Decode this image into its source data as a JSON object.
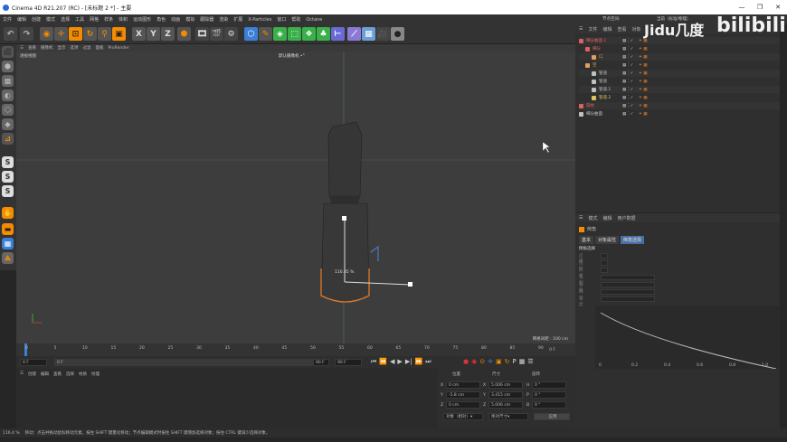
{
  "window": {
    "title": "Cinema 4D R21.207 (RC) - [未标题 2 *] - 主要",
    "min": "—",
    "max": "❐",
    "close": "✕"
  },
  "menubar": [
    "文件",
    "编辑",
    "创建",
    "模式",
    "选择",
    "工具",
    "网格",
    "样条",
    "体积",
    "运动图形",
    "角色",
    "动画",
    "模拟",
    "跟踪器",
    "渲染",
    "扩展",
    "X-Particles",
    "窗口",
    "帮助",
    "Octane"
  ],
  "toolbar_icons": [
    "undo-icon",
    "redo-icon",
    "select-icon",
    "move-icon",
    "scale-icon",
    "rotate-icon",
    "last-icon",
    "axis-x-icon",
    "axis-y-icon",
    "axis-z-icon",
    "world-icon",
    "render-view-icon",
    "render-icon",
    "render-settings-icon",
    "cube-icon",
    "pen-icon",
    "subdivision-icon",
    "array-icon",
    "deformer-icon",
    "scene-icon",
    "effector-icon",
    "joint-icon",
    "light-icon",
    "camera-icon",
    "sphere-icon"
  ],
  "toolbar_axes": [
    "X",
    "Y",
    "Z"
  ],
  "viewport": {
    "menu": [
      "查看",
      "摄像机",
      "显示",
      "选项",
      "过滤",
      "面板",
      "ProRender"
    ],
    "label": "透视视图",
    "camera": "默认摄像机 •°",
    "grid_info": "网格间距 : 100 cm",
    "percent": "116.85 %"
  },
  "timeline": {
    "ticks": [
      "0",
      "5",
      "10",
      "15",
      "20",
      "25",
      "30",
      "35",
      "40",
      "45",
      "50",
      "55",
      "60",
      "65",
      "70",
      "75",
      "80",
      "85",
      "90"
    ],
    "end": "0 F"
  },
  "playbar": {
    "start": "0 F",
    "current": "0 F",
    "end1": "90 F",
    "end2": "90 F"
  },
  "material": {
    "menu": [
      "创建",
      "编辑",
      "查看",
      "选择",
      "材质",
      "纹理"
    ]
  },
  "coords": {
    "headers": [
      "位置",
      "尺寸",
      "旋转"
    ],
    "rows": [
      {
        "axis": "X",
        "pos": "0 cm",
        "size_axis": "X",
        "size": "5.006 cm",
        "rot_axis": "H",
        "rot": "0 °"
      },
      {
        "axis": "Y",
        "pos": "-5.8 cm",
        "size_axis": "Y",
        "size": "3.415 cm",
        "rot_axis": "P",
        "rot": "0 °"
      },
      {
        "axis": "Z",
        "pos": "0 cm",
        "size_axis": "Z",
        "size": "5.006 cm",
        "rot_axis": "B",
        "rot": "0 °"
      }
    ],
    "mode1": "对象（相对）",
    "mode2": "绝对尺寸",
    "apply": "应用"
  },
  "objects_panel": {
    "menu": [
      "文件",
      "编辑",
      "查看",
      "对象"
    ],
    "layout": "节点空间:",
    "layout_value": "当前（标准/物理）",
    "rows": [
      {
        "name": "细分曲面.1",
        "indent": 0,
        "color": "#e06060"
      },
      {
        "name": "细分",
        "indent": 1,
        "color": "#e06060"
      },
      {
        "name": "口",
        "indent": 2,
        "color": "#e0a060"
      },
      {
        "name": "空",
        "indent": 1,
        "color": "#e0a060"
      },
      {
        "name": "管道",
        "indent": 2,
        "color": "#c0c0c0"
      },
      {
        "name": "管道",
        "indent": 2,
        "color": "#c0c0c0"
      },
      {
        "name": "管道.1",
        "indent": 2,
        "color": "#c0c0c0"
      },
      {
        "name": "管道.2",
        "indent": 2,
        "color": "#e0c060"
      },
      {
        "name": "圆柱",
        "indent": 0,
        "color": "#e06060"
      },
      {
        "name": "细分曲面",
        "indent": 0,
        "color": "#c0c0c0"
      }
    ]
  },
  "attributes_panel": {
    "menu": [
      "模式",
      "编辑",
      "用户数据"
    ],
    "title": "倒角",
    "tabs": [
      "基本",
      "对象属性",
      "倒角选择"
    ],
    "section": "倒角选择",
    "fields": [
      "启用",
      "图层",
      "形状",
      "限制",
      "偏移",
      "细分",
      "深度"
    ]
  },
  "statusbar": {
    "zoom": "116.4 %",
    "hint": "移动：点击并拖动鼠标移动元素。按住 SHIFT 键量化移动；节点编辑模式时按住 SHIFT 键增加选择对象；按住 CTRL 键减少选择对象。"
  },
  "watermark": {
    "baidu": "Jidu几度",
    "bili": "bilibili"
  },
  "graph": {
    "ticks": [
      "0",
      "0.2",
      "0.4",
      "0.6",
      "0.8",
      "1.0"
    ]
  },
  "colors": {
    "accent": "#f58b00",
    "bg": "#262626",
    "panel": "#2f2f2f",
    "viewport": "#3d3d3d",
    "selection": "#4a6fa5",
    "x_axis": "#c04040",
    "y_axis": "#40c040",
    "object_outline": "#e07a2a"
  }
}
